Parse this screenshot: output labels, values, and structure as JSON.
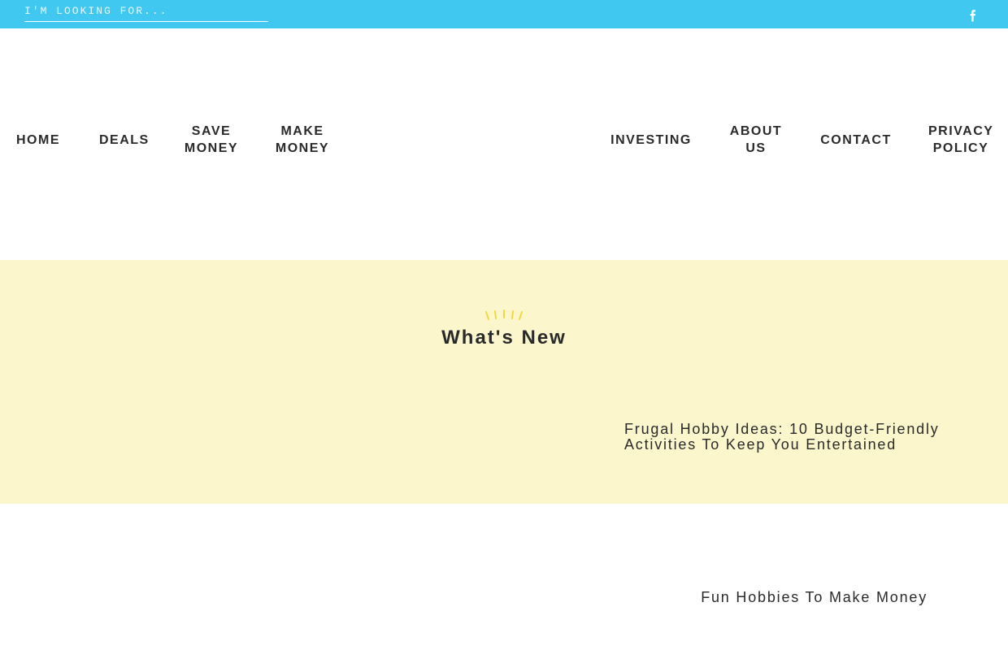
{
  "search": {
    "placeholder": "I'M LOOKING FOR..."
  },
  "social": {
    "icon": "facebook-icon"
  },
  "nav": {
    "home": "HOME",
    "deals": "DEALS",
    "save_money_1": "SAVE",
    "save_money_2": "MONEY",
    "make_money_1": "MAKE",
    "make_money_2": "MONEY",
    "investing": "INVESTING",
    "about_1": "ABOUT",
    "about_2": "US",
    "contact": "CONTACT",
    "privacy_1": "PRIVACY",
    "privacy_2": "POLICY"
  },
  "whats_new": {
    "title": "What's New",
    "post_title": "Frugal Hobby Ideas: 10 Budget-Friendly Activities To Keep You Entertained"
  },
  "second_post": {
    "title": "Fun Hobbies To Make Money"
  },
  "colors": {
    "topbar": "#40c8f0",
    "section_bg": "#fbf6cc",
    "accent": "#f2d93a"
  }
}
